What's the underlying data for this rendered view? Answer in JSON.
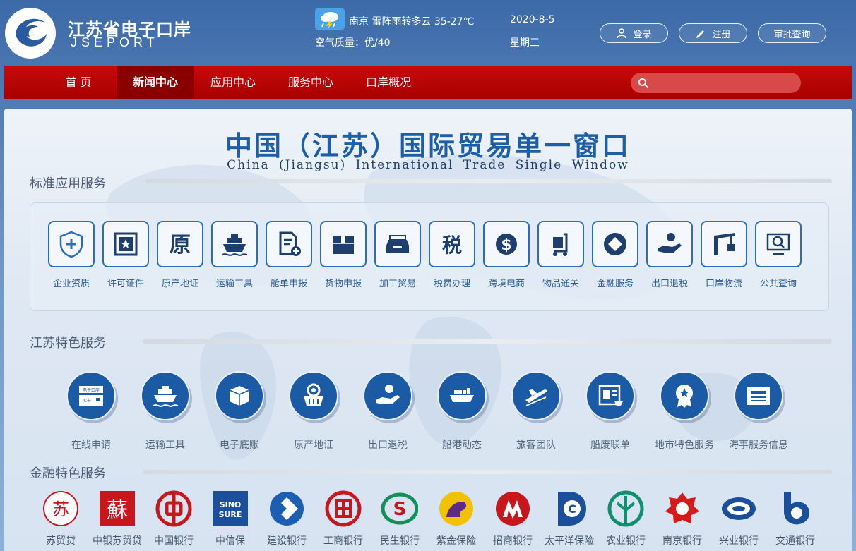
{
  "header": {
    "logo_cn": "江苏省电子口岸",
    "logo_en": "JSEPORT",
    "weather": "南京  雷阵雨转多云 35-27℃",
    "air_quality": "空气质量：优/40",
    "date": "2020-8-5",
    "weekday": "星期三",
    "login_label": "登录",
    "register_label": "注册",
    "query_label": "审批查询"
  },
  "nav": {
    "items": [
      "首 页",
      "新闻中心",
      "应用中心",
      "服务中心",
      "口岸概况"
    ],
    "active_index": 1,
    "search_placeholder": ""
  },
  "main": {
    "title_cn": "中国（江苏）国际贸易单一窗口",
    "title_en": "China (Jiangsu) International Trade Single Window",
    "standard_title": "标准应用服务",
    "jiangsu_title": "江苏特色服务",
    "finance_title": "金融特色服务",
    "standard_items": [
      {
        "label": "企业资质",
        "icon": "shield-plus-icon"
      },
      {
        "label": "许可证件",
        "icon": "certificate-icon"
      },
      {
        "label": "原产地证",
        "icon": "origin-icon"
      },
      {
        "label": "运输工具",
        "icon": "ship-icon"
      },
      {
        "label": "舱单申报",
        "icon": "document-add-icon"
      },
      {
        "label": "货物申报",
        "icon": "box-icon"
      },
      {
        "label": "加工贸易",
        "icon": "tray-icon"
      },
      {
        "label": "税费办理",
        "icon": "tax-icon"
      },
      {
        "label": "跨境电商",
        "icon": "globe-dollar-icon"
      },
      {
        "label": "物品通关",
        "icon": "cart-icon"
      },
      {
        "label": "金融服务",
        "icon": "coin-icon"
      },
      {
        "label": "出口退税",
        "icon": "hand-coin-icon"
      },
      {
        "label": "口岸物流",
        "icon": "crane-icon"
      },
      {
        "label": "公共查询",
        "icon": "magnifier-chart-icon"
      }
    ],
    "jiangsu_items": [
      {
        "label": "在线申请",
        "icon": "ic-card-icon",
        "card_top": "电子口岸",
        "card_bottom": "IC卡"
      },
      {
        "label": "运输工具",
        "icon": "ship-icon"
      },
      {
        "label": "电子底账",
        "icon": "box-icon"
      },
      {
        "label": "原产地证",
        "icon": "basket-icon"
      },
      {
        "label": "出口退税",
        "icon": "hand-coin-icon"
      },
      {
        "label": "船港动态",
        "icon": "cargo-ship-icon"
      },
      {
        "label": "旅客团队",
        "icon": "airplane-icon"
      },
      {
        "label": "船废联单",
        "icon": "trash-form-icon"
      },
      {
        "label": "地市特色服务",
        "icon": "badge-icon"
      },
      {
        "label": "海事服务信息",
        "icon": "newspaper-icon"
      }
    ],
    "banks": [
      {
        "label": "苏贸贷",
        "color": "#c8161d"
      },
      {
        "label": "中银苏贸贷",
        "color": "#c8161d",
        "glyph": "蘇"
      },
      {
        "label": "中国银行",
        "color": "#c8161d"
      },
      {
        "label": "中信保",
        "color": "#1b4f9c",
        "glyph": "SINO SURE"
      },
      {
        "label": "建设银行",
        "color": "#1c5fb2"
      },
      {
        "label": "工商银行",
        "color": "#c8161d"
      },
      {
        "label": "民生银行",
        "color": "#11905a"
      },
      {
        "label": "紫金保险",
        "color": "#5d2a86"
      },
      {
        "label": "招商银行",
        "color": "#c8161d"
      },
      {
        "label": "太平洋保险",
        "color": "#1b4f9c"
      },
      {
        "label": "农业银行",
        "color": "#0f8f6d"
      },
      {
        "label": "南京银行",
        "color": "#d61a1a"
      },
      {
        "label": "兴业银行",
        "color": "#1b4f9c"
      },
      {
        "label": "交通银行",
        "color": "#1b4f9c"
      }
    ]
  }
}
